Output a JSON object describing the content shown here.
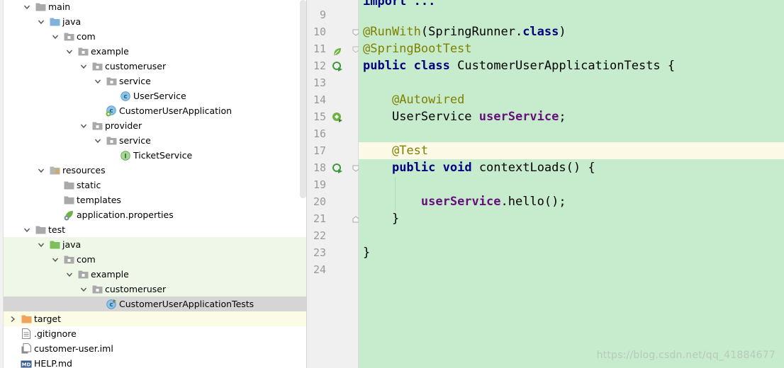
{
  "project_tree": {
    "items": [
      {
        "label": "main",
        "icon": "folder-icon",
        "expanded": true
      },
      {
        "label": "java",
        "icon": "source-folder-icon",
        "expanded": true
      },
      {
        "label": "com",
        "icon": "package-icon",
        "expanded": true
      },
      {
        "label": "example",
        "icon": "package-icon",
        "expanded": true
      },
      {
        "label": "customeruser",
        "icon": "package-icon",
        "expanded": true
      },
      {
        "label": "service",
        "icon": "package-icon",
        "expanded": true
      },
      {
        "label": "UserService",
        "icon": "class-icon"
      },
      {
        "label": "CustomerUserApplication",
        "icon": "spring-boot-class-icon"
      },
      {
        "label": "provider",
        "icon": "package-icon",
        "expanded": true
      },
      {
        "label": "service",
        "icon": "package-icon",
        "expanded": true
      },
      {
        "label": "TicketService",
        "icon": "interface-icon"
      },
      {
        "label": "resources",
        "icon": "resources-folder-icon",
        "expanded": true
      },
      {
        "label": "static",
        "icon": "folder-icon"
      },
      {
        "label": "templates",
        "icon": "folder-icon"
      },
      {
        "label": "application.properties",
        "icon": "spring-properties-icon"
      },
      {
        "label": "test",
        "icon": "folder-icon",
        "expanded": true
      },
      {
        "label": "java",
        "icon": "test-source-folder-icon",
        "expanded": true
      },
      {
        "label": "com",
        "icon": "package-icon",
        "expanded": true
      },
      {
        "label": "example",
        "icon": "package-icon",
        "expanded": true
      },
      {
        "label": "customeruser",
        "icon": "package-icon",
        "expanded": true
      },
      {
        "label": "CustomerUserApplicationTests",
        "icon": "test-class-icon",
        "selected": true
      },
      {
        "label": "target",
        "icon": "excluded-folder-icon",
        "expanded": false
      },
      {
        "label": ".gitignore",
        "icon": "text-file-icon"
      },
      {
        "label": "customer-user.iml",
        "icon": "module-file-icon"
      },
      {
        "label": "HELP.md",
        "icon": "markdown-file-icon"
      }
    ]
  },
  "editor": {
    "line_numbers": [
      "9",
      "10",
      "11",
      "12",
      "13",
      "14",
      "15",
      "16",
      "17",
      "18",
      "19",
      "20",
      "21",
      "22",
      "23",
      "24"
    ],
    "folded_import": "import ...",
    "code": {
      "l10_ann": "@RunWith",
      "l10_rest": "(SpringRunner.",
      "l10_kw": "class",
      "l10_end": ")",
      "l11_ann": "@SpringBootTest",
      "l12_kw1": "public",
      "l12_kw2": "class",
      "l12_name": " CustomerUserApplicationTests {",
      "l14_ann": "@Autowired",
      "l15_type": "UserService ",
      "l15_field": "userService",
      "l15_end": ";",
      "l17_ann": "@Test",
      "l18_kw1": "public",
      "l18_kw2": "void",
      "l18_rest": " contextLoads() {",
      "l20_field": "userService",
      "l20_rest": ".hello();",
      "l21": "}",
      "l23": "}"
    },
    "current_line": "17",
    "background_color": "#c6eccd"
  },
  "watermark": "https://blog.csdn.net/qq_41884677"
}
